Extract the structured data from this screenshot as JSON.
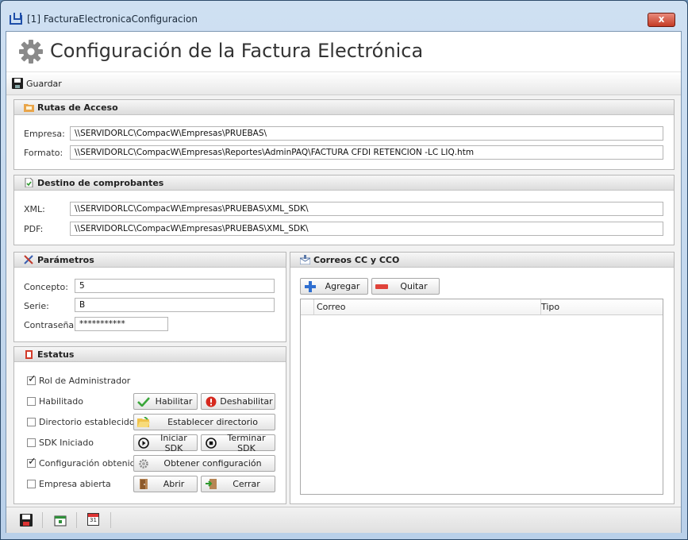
{
  "window": {
    "title": "[1] FacturaElectronicaConfiguracion",
    "close_label": "x"
  },
  "header": {
    "title": "Configuración de la Factura Electrónica"
  },
  "toolbar": {
    "save_label": "Guardar"
  },
  "rutas": {
    "title": "Rutas de Acceso",
    "empresa_label": "Empresa:",
    "empresa_value": "\\\\SERVIDORLC\\CompacW\\Empresas\\PRUEBAS\\",
    "formato_label": "Formato:",
    "formato_value": "\\\\SERVIDORLC\\CompacW\\Empresas\\Reportes\\AdminPAQ\\FACTURA CFDI RETENCION -LC LIQ.htm"
  },
  "destino": {
    "title": "Destino de comprobantes",
    "xml_label": "XML:",
    "xml_value": "\\\\SERVIDORLC\\CompacW\\Empresas\\PRUEBAS\\XML_SDK\\",
    "pdf_label": "PDF:",
    "pdf_value": "\\\\SERVIDORLC\\CompacW\\Empresas\\PRUEBAS\\XML_SDK\\"
  },
  "parametros": {
    "title": "Parámetros",
    "concepto_label": "Concepto:",
    "concepto_value": "5",
    "serie_label": "Serie:",
    "serie_value": "B",
    "password_label": "Contraseña:",
    "password_value": "***********"
  },
  "estatus": {
    "title": "Estatus",
    "items": [
      {
        "label": "Rol de Administrador",
        "checked": true
      },
      {
        "label": "Habilitado",
        "checked": false
      },
      {
        "label": "Directorio establecido",
        "checked": false
      },
      {
        "label": "SDK Iniciado",
        "checked": false
      },
      {
        "label": "Configuración obtenida",
        "checked": true
      },
      {
        "label": "Empresa abierta",
        "checked": false
      }
    ],
    "buttons": {
      "habilitar": "Habilitar",
      "deshabilitar": "Deshabilitar",
      "establecer": "Establecer directorio",
      "iniciar": "Iniciar SDK",
      "terminar": "Terminar SDK",
      "obtener": "Obtener configuración",
      "abrir": "Abrir",
      "cerrar": "Cerrar"
    }
  },
  "correos": {
    "title": "Correos CC y CCO",
    "add_label": "Agregar",
    "remove_label": "Quitar",
    "columns": [
      "Correo",
      "Tipo"
    ]
  },
  "statusbar": {
    "calendar_day": "31"
  }
}
